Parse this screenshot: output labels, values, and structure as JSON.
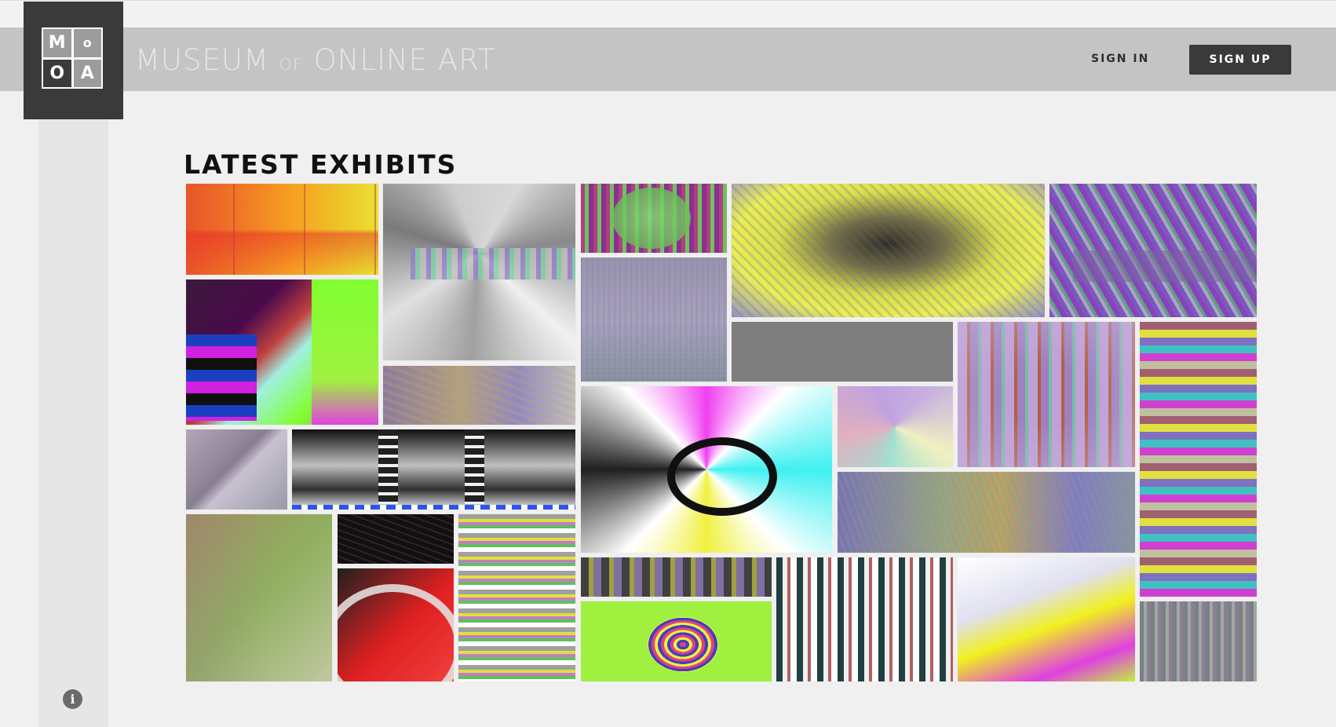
{
  "header": {
    "logo_letters": [
      "M",
      "o",
      "O",
      "A"
    ],
    "title_main_1": "MUSEUM",
    "title_of": "OF",
    "title_main_2": "ONLINE ART",
    "sign_in_label": "SIGN IN",
    "sign_up_label": "SIGN UP"
  },
  "main": {
    "section_title": "LATEST EXHIBITS"
  },
  "sidebar": {
    "info_icon": "info-icon",
    "info_glyph": "i"
  },
  "colors": {
    "header_bg": "#c4c4c4",
    "dark": "#3a3a3a",
    "page_bg": "#f0f0f0",
    "sidebar_bg": "#e6e6e6"
  }
}
